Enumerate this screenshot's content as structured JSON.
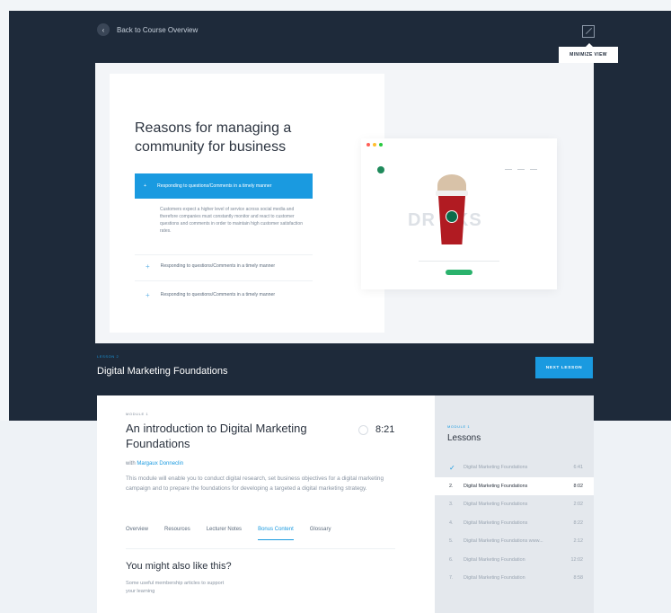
{
  "header": {
    "back_label": "Back to Course Overview",
    "back_icon": "chevron-left-icon",
    "minimize_icon": "minimize-icon",
    "tooltip": "MINIMIZE VIEW"
  },
  "slide": {
    "title": "Reasons for managing a community for business",
    "accordion_active": "Responding to questions/Comments in a timely manner",
    "accordion_body": "Customers expect a higher level of service across social media and therefore companies must constantly monitor and react to customer questions and comments in order to maintain high customer satisfaction rates.",
    "accordion_items": [
      "Responding to questions/Comments in a timely manner",
      "Responding to questions/Comments in a timely manner"
    ],
    "browser_word": "DR  NKS",
    "browser_dot_colors": [
      "#ff5f56",
      "#ffbd2e",
      "#27c93f"
    ]
  },
  "lesson_bar": {
    "label": "LESSON 2",
    "title": "Digital Marketing Foundations",
    "next_button": "NEXT LESSON"
  },
  "module": {
    "label": "MODULE 1",
    "title": "An introduction to Digital Marketing Foundations",
    "duration": "8:21",
    "author_prefix": "with",
    "author_name": "Margaux Donneclin",
    "description": "This module will enable you to conduct digital research, set business objectives for a digital marketing campaign and to prepare the foundations for developing a targeted a digital marketing strategy.",
    "tabs": [
      "Overview",
      "Resources",
      "Lecturer Notes",
      "Bonus Content",
      "Glossary"
    ],
    "active_tab": "Bonus Content",
    "suggest_title": "You might also like this?",
    "suggest_text": "Some useful membership articles to support your learning"
  },
  "lessons": {
    "label": "MODULE 1",
    "title": "Lessons",
    "items": [
      {
        "num": "✓",
        "name": "Digital Marketing Foundations",
        "time": "6:41"
      },
      {
        "num": "2.",
        "name": "Digital Marketing Foundations",
        "time": "8:02"
      },
      {
        "num": "3.",
        "name": "Digital Marketing Foundations",
        "time": "2:02"
      },
      {
        "num": "4.",
        "name": "Digital Marketing Foundations",
        "time": "8:22"
      },
      {
        "num": "5.",
        "name": "Digital Marketing Foundations www...",
        "time": "2:12"
      },
      {
        "num": "6.",
        "name": "Digital Marketing Foundation",
        "time": "12:02"
      },
      {
        "num": "7.",
        "name": "Digital Marketing Foundation",
        "time": "8:58"
      }
    ],
    "current_index": 1
  },
  "colors": {
    "dark": "#1e2a3a",
    "accent": "#1a9ae0",
    "panel": "#e4e8ed"
  }
}
